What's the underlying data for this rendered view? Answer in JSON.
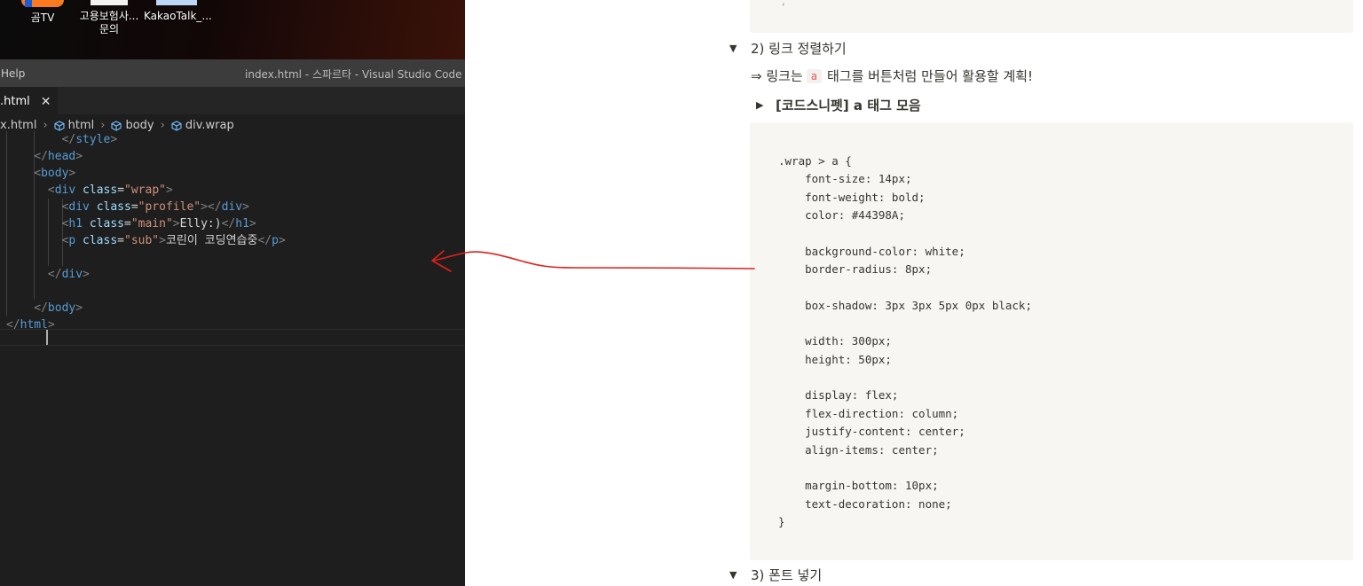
{
  "desktop": {
    "icons": [
      {
        "label": "곰TV",
        "icon": "gomtv-icon"
      },
      {
        "label": "고용보험사...\n문의",
        "label_line1": "고용보험사...",
        "label_line2": "문의",
        "icon": "document-icon"
      },
      {
        "label": "KakaoTalk_...",
        "icon": "kakaotalk-file-icon"
      }
    ]
  },
  "vscode": {
    "menu_partial": "Help",
    "window_title": "index.html - 스파르타 - Visual Studio Code",
    "tab": {
      "label": ".html",
      "close_glyph": "✕"
    },
    "breadcrumb": [
      "x.html",
      "html",
      "body",
      "div.wrap"
    ],
    "code_lines": [
      {
        "indent": 8,
        "tokens": [
          [
            "punc",
            "</"
          ],
          [
            "tag",
            "style"
          ],
          [
            "punc",
            ">"
          ]
        ]
      },
      {
        "indent": 4,
        "tokens": [
          [
            "punc",
            "</"
          ],
          [
            "tag",
            "head"
          ],
          [
            "punc",
            ">"
          ]
        ]
      },
      {
        "indent": 4,
        "tokens": [
          [
            "punc",
            "<"
          ],
          [
            "tag",
            "body"
          ],
          [
            "punc",
            ">"
          ]
        ]
      },
      {
        "indent": 6,
        "tokens": [
          [
            "punc",
            "<"
          ],
          [
            "tag",
            "div"
          ],
          [
            "text",
            " "
          ],
          [
            "attr",
            "class"
          ],
          [
            "text",
            "="
          ],
          [
            "str",
            "\"wrap\""
          ],
          [
            "punc",
            ">"
          ]
        ]
      },
      {
        "indent": 8,
        "tokens": [
          [
            "punc",
            "<"
          ],
          [
            "tag",
            "div"
          ],
          [
            "text",
            " "
          ],
          [
            "attr",
            "class"
          ],
          [
            "text",
            "="
          ],
          [
            "str",
            "\"profile\""
          ],
          [
            "punc",
            "></"
          ],
          [
            "tag",
            "div"
          ],
          [
            "punc",
            ">"
          ]
        ]
      },
      {
        "indent": 8,
        "tokens": [
          [
            "punc",
            "<"
          ],
          [
            "tag",
            "h1"
          ],
          [
            "text",
            " "
          ],
          [
            "attr",
            "class"
          ],
          [
            "text",
            "="
          ],
          [
            "str",
            "\"main\""
          ],
          [
            "punc",
            ">"
          ],
          [
            "text",
            "Elly:)"
          ],
          [
            "punc",
            "</"
          ],
          [
            "tag",
            "h1"
          ],
          [
            "punc",
            ">"
          ]
        ]
      },
      {
        "indent": 8,
        "tokens": [
          [
            "punc",
            "<"
          ],
          [
            "tag",
            "p"
          ],
          [
            "text",
            " "
          ],
          [
            "attr",
            "class"
          ],
          [
            "text",
            "="
          ],
          [
            "str",
            "\"sub\""
          ],
          [
            "punc",
            ">"
          ],
          [
            "text",
            "코린이 코딩연습중"
          ],
          [
            "punc",
            "</"
          ],
          [
            "tag",
            "p"
          ],
          [
            "punc",
            ">"
          ]
        ]
      },
      {
        "indent": 8,
        "tokens": []
      },
      {
        "indent": 6,
        "tokens": [
          [
            "punc",
            "</"
          ],
          [
            "tag",
            "div"
          ],
          [
            "punc",
            ">"
          ]
        ]
      },
      {
        "indent": 4,
        "tokens": []
      },
      {
        "indent": 4,
        "tokens": [
          [
            "punc",
            "</"
          ],
          [
            "tag",
            "body"
          ],
          [
            "punc",
            ">"
          ]
        ]
      },
      {
        "indent": 0,
        "tokens": [
          [
            "punc",
            "</"
          ],
          [
            "tag",
            "html"
          ],
          [
            "punc",
            ">"
          ]
        ]
      }
    ]
  },
  "notion": {
    "toggle_links": {
      "arrow": "▼",
      "title": "2) 링크 정렬하기"
    },
    "paragraph": {
      "prefix": "⇒ 링크는",
      "code": "a",
      "suffix": "태그를 버튼처럼 만들어 활용할 계획!"
    },
    "snippet_toggle": {
      "arrow": "▶",
      "title": "[코드스니펫] a 태그 모음"
    },
    "code": ".wrap > a {\n    font-size: 14px;\n    font-weight: bold;\n    color: #44398A;\n\n    background-color: white;\n    border-radius: 8px;\n\n    box-shadow: 3px 3px 5px 0px black;\n\n    width: 300px;\n    height: 50px;\n\n    display: flex;\n    flex-direction: column;\n    justify-content: center;\n    align-items: center;\n\n    margin-bottom: 10px;\n    text-decoration: none;\n}",
    "toggle_font": {
      "arrow": "▼",
      "title": "3) 폰트 넣기"
    }
  },
  "colors": {
    "annotation": "#e0201a",
    "vscode_tag": "#569cd6",
    "vscode_attr": "#9cdcfe",
    "vscode_string": "#ce9178"
  }
}
